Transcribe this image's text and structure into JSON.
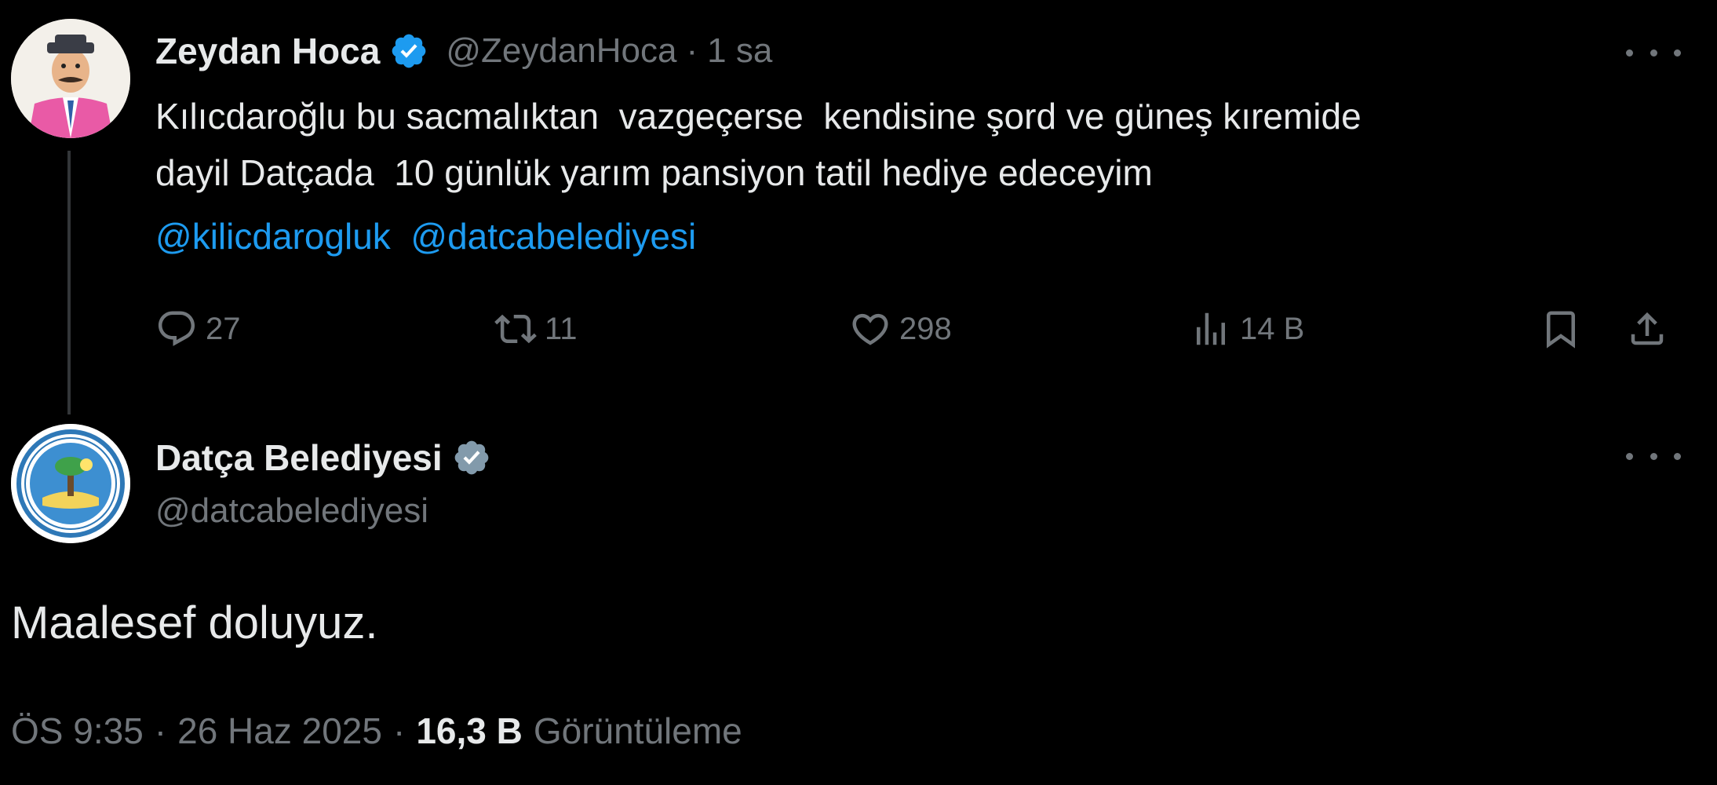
{
  "original_tweet": {
    "author": {
      "display_name": "Zeydan Hoca",
      "handle": "@ZeydanHoca",
      "verified_badge_color": "#1d9bf0",
      "avatar": "cartoon-man-avatar"
    },
    "separator": "·",
    "time": "1 sa",
    "text_line_1": "Kılıcdaroğlu bu sacmalıktan  vazgeçerse  kendisine şord ve güneş kıremide",
    "text_line_2": "dayil Datçada  10 günlük yarım pansiyon tatil hediye edeceyim",
    "mentions": [
      "@kilicdarogluk",
      "@datcabelediyesi"
    ],
    "actions": {
      "reply": {
        "icon": "reply-icon",
        "count": "27"
      },
      "retweet": {
        "icon": "retweet-icon",
        "count": "11"
      },
      "like": {
        "icon": "heart-icon",
        "count": "298"
      },
      "views": {
        "icon": "views-icon",
        "count": "14 B"
      },
      "bookmark": {
        "icon": "bookmark-icon"
      },
      "share": {
        "icon": "share-icon"
      }
    }
  },
  "reply_tweet": {
    "author": {
      "display_name": "Datça Belediyesi",
      "handle": "@datcabelediyesi",
      "verified_badge_color": "#829aab",
      "avatar": "municipality-logo-avatar"
    },
    "text": "Maalesef doluyuz.",
    "timestamp": "ÖS 9:35",
    "separator": "·",
    "date": "26 Haz 2025",
    "view_count": "16,3 B",
    "view_label": "Görüntüleme"
  },
  "colors": {
    "background": "#000000",
    "primary_text": "#e7e9ea",
    "secondary_text": "#71767b",
    "link": "#1d9bf0",
    "thread_line": "#333639"
  }
}
